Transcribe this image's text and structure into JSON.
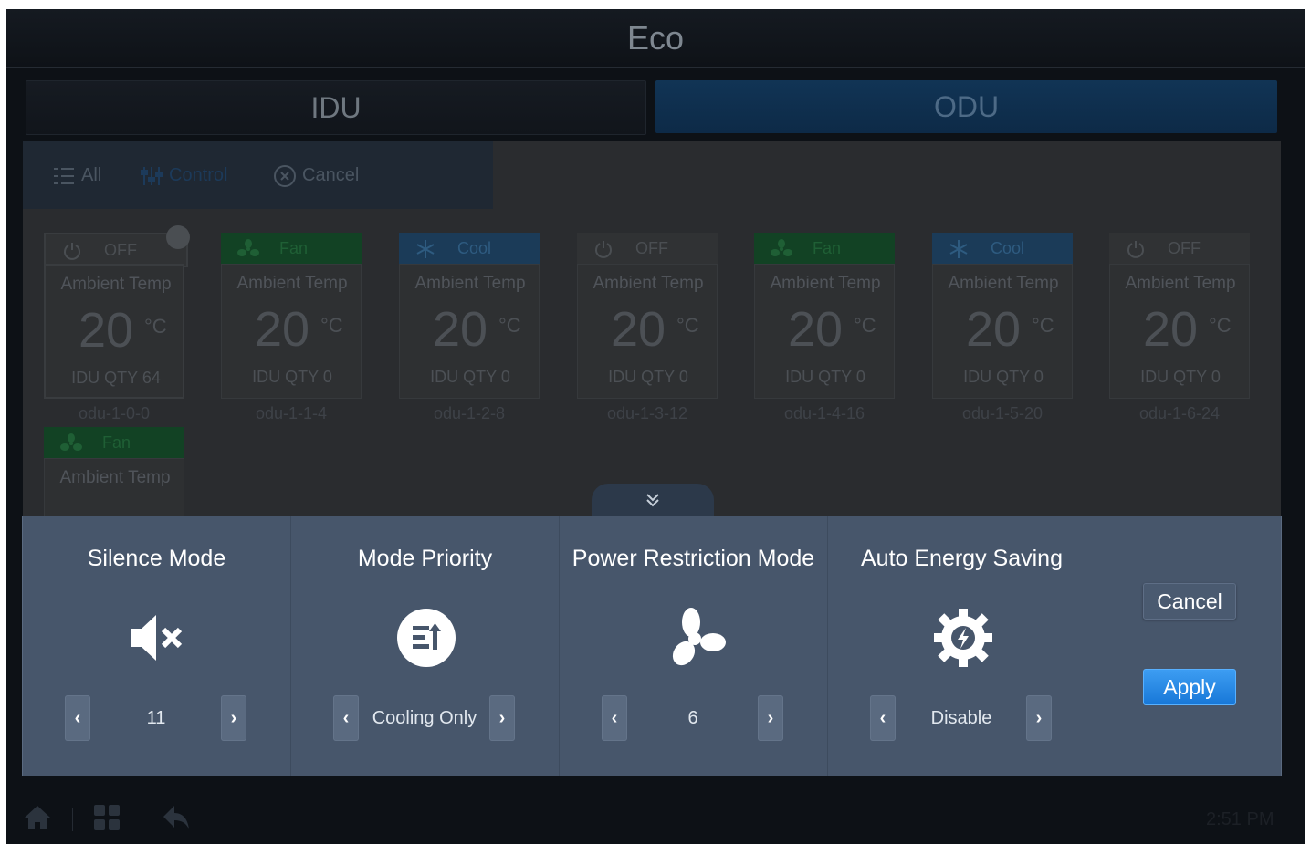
{
  "header": {
    "title": "Eco"
  },
  "tabs": [
    {
      "label": "IDU",
      "selected": false
    },
    {
      "label": "ODU",
      "selected": true
    }
  ],
  "toolbar": {
    "all_label": "All",
    "control_label": "Control",
    "cancel_label": "Cancel"
  },
  "units": [
    {
      "mode": "OFF",
      "mode_icon": "power-icon",
      "ambient_label": "Ambient Temp",
      "temp": "20",
      "unit": "°C",
      "qty": "IDU QTY 64",
      "name": "odu-1-0-0",
      "selected": true
    },
    {
      "mode": "Fan",
      "mode_icon": "fan-icon",
      "ambient_label": "Ambient Temp",
      "temp": "20",
      "unit": "°C",
      "qty": "IDU QTY 0",
      "name": "odu-1-1-4"
    },
    {
      "mode": "Cool",
      "mode_icon": "snowflake-icon",
      "ambient_label": "Ambient Temp",
      "temp": "20",
      "unit": "°C",
      "qty": "IDU QTY 0",
      "name": "odu-1-2-8"
    },
    {
      "mode": "OFF",
      "mode_icon": "power-icon",
      "ambient_label": "Ambient Temp",
      "temp": "20",
      "unit": "°C",
      "qty": "IDU QTY 0",
      "name": "odu-1-3-12"
    },
    {
      "mode": "Fan",
      "mode_icon": "fan-icon",
      "ambient_label": "Ambient Temp",
      "temp": "20",
      "unit": "°C",
      "qty": "IDU QTY 0",
      "name": "odu-1-4-16"
    },
    {
      "mode": "Cool",
      "mode_icon": "snowflake-icon",
      "ambient_label": "Ambient Temp",
      "temp": "20",
      "unit": "°C",
      "qty": "IDU QTY 0",
      "name": "odu-1-5-20"
    },
    {
      "mode": "OFF",
      "mode_icon": "power-icon",
      "ambient_label": "Ambient Temp",
      "temp": "20",
      "unit": "°C",
      "qty": "IDU QTY 0",
      "name": "odu-1-6-24"
    },
    {
      "mode": "Fan",
      "mode_icon": "fan-icon",
      "ambient_label": "Ambient Temp"
    }
  ],
  "settings": [
    {
      "title": "Silence Mode",
      "icon": "mute-speaker-icon",
      "value": "11"
    },
    {
      "title": "Mode Priority",
      "icon": "priority-icon",
      "value": "Cooling Only"
    },
    {
      "title": "Power Restriction Mode",
      "icon": "fan-blade-icon",
      "value": "6"
    },
    {
      "title": "Auto Energy Saving",
      "icon": "energy-gear-icon",
      "value": "Disable"
    }
  ],
  "actions": {
    "cancel_label": "Cancel",
    "apply_label": "Apply"
  },
  "footer": {
    "time": "2:51 PM"
  },
  "colors": {
    "panel": "#47566b",
    "apply": "#1f86e6",
    "fan_head": "#124224",
    "cool_head": "#1b3b58"
  }
}
